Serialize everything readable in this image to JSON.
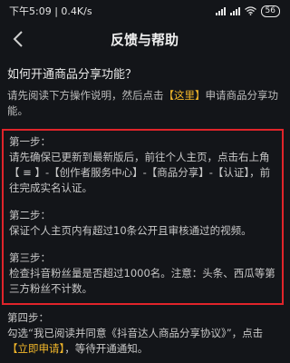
{
  "status_bar": {
    "time_speed": "下午5:09 | 0.4K/s",
    "battery": "56"
  },
  "header": {
    "title": "反馈与帮助"
  },
  "main": {
    "question": "如何开通商品分享功能？",
    "intro_before": "请先阅读下方操作说明，然后点击",
    "intro_link": "【这里】",
    "intro_after": "申请商品分享功能。",
    "steps": [
      {
        "title": "第一步：",
        "body": "请先确保已更新到最新版后，前往个人主页，点击右上角【 ≡ 】-【创作者服务中心】-【商品分享】-【认证】，前往完成实名认证。"
      },
      {
        "title": "第二步：",
        "body": "保证个人主页内有超过10条公开且审核通过的视频。"
      },
      {
        "title": "第三步：",
        "body": "检查抖音粉丝量是否超过1000名。注意：头条、西瓜等第三方粉丝不计数。"
      }
    ],
    "step4": {
      "title": "第四步：",
      "body_before": "勾选“我已阅读并同意《抖音达人商品分享协议》”，点击",
      "body_link": "【立即申请】",
      "body_after": "，等待开通通知。"
    }
  },
  "colors": {
    "background": "#131519",
    "highlight": "#f2b72a",
    "box_border": "#e0242a"
  }
}
